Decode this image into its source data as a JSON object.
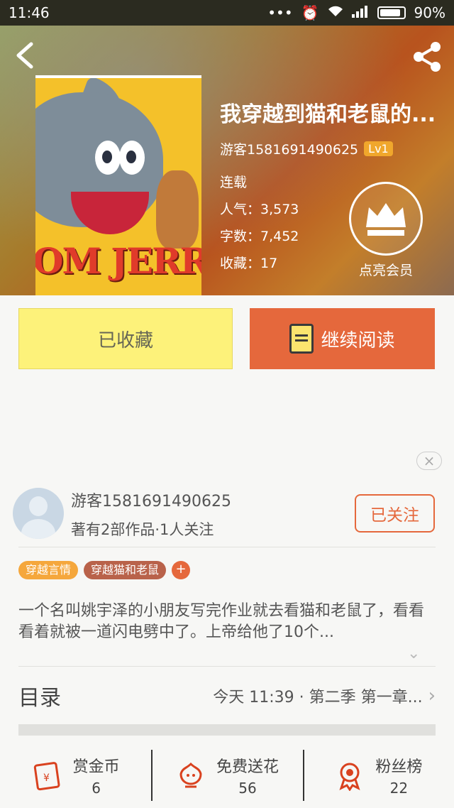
{
  "status_bar": {
    "time": "11:46",
    "battery": "90%"
  },
  "book": {
    "title": "我穿越到猫和老鼠的...",
    "author": "游客1581691490625",
    "level": "Lv1",
    "status": "连载",
    "popularity": "人气：3,573",
    "word_count": "字数：7,452",
    "favorites": "收藏：17",
    "cover_logo": "OM JERRY"
  },
  "member": {
    "label": "点亮会员"
  },
  "actions": {
    "collected_label": "已收藏",
    "read_label": "继续阅读"
  },
  "author_card": {
    "name": "游客1581691490625",
    "stats": "著有2部作品·1人关注",
    "follow_label": "已关注"
  },
  "tags": [
    "穿越言情",
    "穿越猫和老鼠",
    "+"
  ],
  "description": "一个名叫姚宇泽的小朋友写完作业就去看猫和老鼠了，看看看着就被一道闪电劈中了。上帝给他了10个...",
  "toc": {
    "label": "目录",
    "latest": "今天 11:39 · 第二季  第一章..."
  },
  "bottom_bar": [
    {
      "name": "赏金币",
      "count": "6",
      "icon": "red-envelope-icon"
    },
    {
      "name": "免费送花",
      "count": "56",
      "icon": "flower-icon"
    },
    {
      "name": "粉丝榜",
      "count": "22",
      "icon": "medal-icon"
    }
  ],
  "colors": {
    "accent": "#e5683c",
    "collected_bg": "#fdf27a",
    "tag1": "#f5a73c",
    "tag2": "#b9624a"
  }
}
